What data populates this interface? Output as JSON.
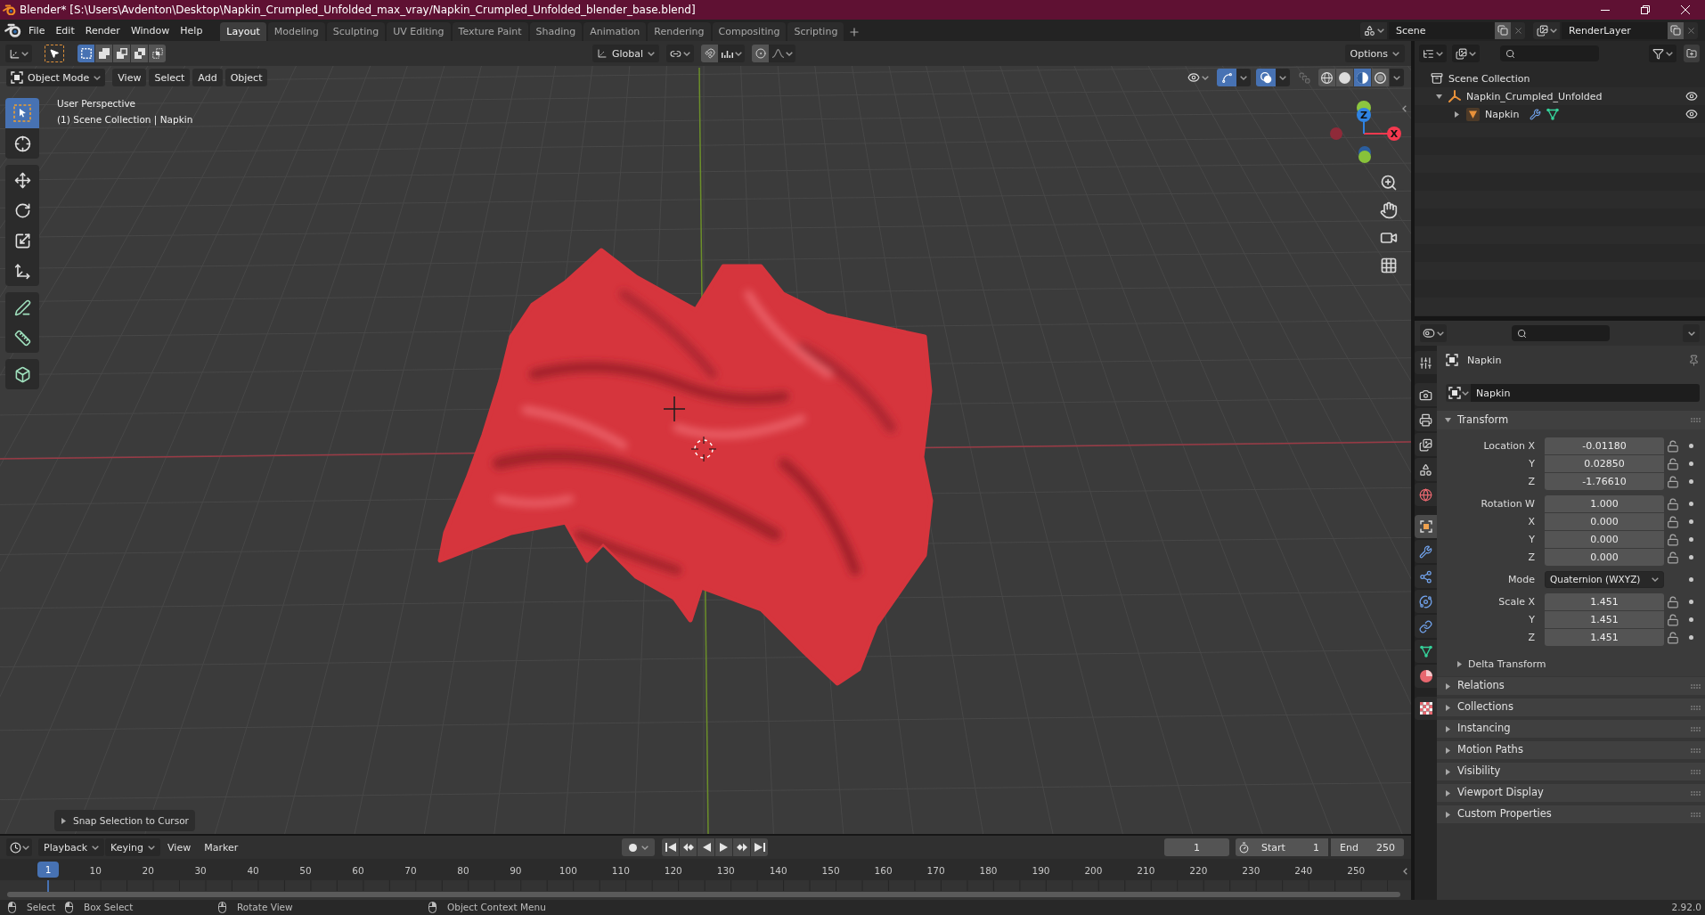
{
  "window": {
    "title": "Blender* [S:\\Users\\Avdenton\\Desktop\\Napkin_Crumpled_Unfolded_max_vray/Napkin_Crumpled_Unfolded_blender_base.blend]"
  },
  "menu": [
    "File",
    "Edit",
    "Render",
    "Window",
    "Help"
  ],
  "workspaces": [
    {
      "label": "Layout",
      "selected": true
    },
    {
      "label": "Modeling",
      "selected": false
    },
    {
      "label": "Sculpting",
      "selected": false
    },
    {
      "label": "UV Editing",
      "selected": false
    },
    {
      "label": "Texture Paint",
      "selected": false
    },
    {
      "label": "Shading",
      "selected": false
    },
    {
      "label": "Animation",
      "selected": false
    },
    {
      "label": "Rendering",
      "selected": false
    },
    {
      "label": "Compositing",
      "selected": false
    },
    {
      "label": "Scripting",
      "selected": false
    }
  ],
  "scene": {
    "value": "Scene"
  },
  "view_layer": {
    "value": "RenderLayer"
  },
  "viewport": {
    "tool_header": {
      "selection_modes": [
        {
          "kind": "set",
          "selected": true
        },
        {
          "kind": "extend",
          "selected": false
        },
        {
          "kind": "subtract",
          "selected": false
        },
        {
          "kind": "invert",
          "selected": false
        },
        {
          "kind": "intersect",
          "selected": false
        }
      ],
      "orientation": "Global",
      "options": "Options"
    },
    "header": {
      "mode": "Object Mode",
      "menus": [
        "View",
        "Select",
        "Add",
        "Object"
      ],
      "shading": [
        {
          "kind": "wireframe",
          "selected": false
        },
        {
          "kind": "solid",
          "selected": false
        },
        {
          "kind": "material",
          "selected": true
        },
        {
          "kind": "rendered",
          "selected": false
        }
      ]
    },
    "info": [
      "User Perspective",
      "(1) Scene Collection | Napkin"
    ],
    "tool_groups": [
      {
        "tools": [
          {
            "kind": "select_box",
            "selected": true
          },
          {
            "kind": "cursor",
            "selected": false
          }
        ]
      },
      {
        "tools": [
          {
            "kind": "move",
            "selected": false
          },
          {
            "kind": "rotate",
            "selected": false
          },
          {
            "kind": "scale",
            "selected": false
          },
          {
            "kind": "transform",
            "selected": false
          }
        ]
      },
      {
        "tools": [
          {
            "kind": "annotate",
            "selected": false
          },
          {
            "kind": "measure",
            "selected": false
          }
        ]
      },
      {
        "tools": [
          {
            "kind": "add_cube",
            "selected": false
          }
        ]
      }
    ],
    "navigation_gizmo": {
      "axes": [
        {
          "kind": "x",
          "label": "X"
        },
        {
          "kind": "z",
          "label": "Z"
        }
      ]
    },
    "last_operator": {
      "title": "Snap Selection to Cursor",
      "expanded": false
    }
  },
  "outliner": {
    "tree": [
      {
        "kind": "collection",
        "label": "Scene Collection",
        "children": [
          {
            "kind": "empty",
            "label": "Napkin_Crumpled_Unfolded",
            "expanded": true,
            "visible": true,
            "children": [
              {
                "kind": "mesh",
                "label": "Napkin",
                "expanded": false,
                "visible": true,
                "extras": [
                  {
                    "kind": "modifier"
                  },
                  {
                    "kind": "mesh_data"
                  }
                ]
              }
            ]
          }
        ]
      }
    ]
  },
  "properties": {
    "tab_groups": [
      {
        "tabs": [
          {
            "kind": "tool",
            "selected": false
          }
        ]
      },
      {
        "tabs": [
          {
            "kind": "render",
            "selected": false
          },
          {
            "kind": "output",
            "selected": false
          },
          {
            "kind": "view_layer",
            "selected": false
          },
          {
            "kind": "scene",
            "selected": false
          },
          {
            "kind": "world",
            "selected": false
          }
        ]
      },
      {
        "tabs": [
          {
            "kind": "object",
            "selected": true
          },
          {
            "kind": "modifiers",
            "selected": false
          },
          {
            "kind": "particles",
            "selected": false
          },
          {
            "kind": "physics",
            "selected": false
          },
          {
            "kind": "constraints",
            "selected": false
          },
          {
            "kind": "data",
            "selected": false
          },
          {
            "kind": "material",
            "selected": false
          }
        ]
      },
      {
        "tabs": [
          {
            "kind": "texture",
            "selected": false
          }
        ]
      }
    ],
    "context": "Napkin",
    "name": "Napkin",
    "transform": {
      "title": "Transform",
      "expanded": true,
      "sections": [
        {
          "kind": "fields",
          "rows": [
            {
              "label": "Location X",
              "value": "-0.01180",
              "locked": false
            },
            {
              "label": "Y",
              "value": "0.02850",
              "locked": false
            },
            {
              "label": "Z",
              "value": "-1.76610",
              "locked": false
            }
          ]
        },
        {
          "kind": "fields",
          "rows": [
            {
              "label": "Rotation W",
              "value": "1.000",
              "locked": false
            },
            {
              "label": "X",
              "value": "0.000",
              "locked": false
            },
            {
              "label": "Y",
              "value": "0.000",
              "locked": false
            },
            {
              "label": "Z",
              "value": "0.000",
              "locked": false
            }
          ]
        },
        {
          "kind": "dropdown",
          "label": "Mode",
          "value": "Quaternion (WXYZ)"
        },
        {
          "kind": "fields",
          "rows": [
            {
              "label": "Scale X",
              "value": "1.451",
              "locked": false
            },
            {
              "label": "Y",
              "value": "1.451",
              "locked": false
            },
            {
              "label": "Z",
              "value": "1.451",
              "locked": false
            }
          ]
        }
      ],
      "subpanels": [
        {
          "title": "Delta Transform",
          "expanded": false
        }
      ]
    },
    "panels": [
      {
        "title": "Relations",
        "expanded": false
      },
      {
        "title": "Collections",
        "expanded": false
      },
      {
        "title": "Instancing",
        "expanded": false
      },
      {
        "title": "Motion Paths",
        "expanded": false
      },
      {
        "title": "Visibility",
        "expanded": false
      },
      {
        "title": "Viewport Display",
        "expanded": false
      },
      {
        "title": "Custom Properties",
        "expanded": false
      }
    ]
  },
  "timeline": {
    "menus": [
      {
        "kind": "dropdown",
        "label": "Playback"
      },
      {
        "kind": "dropdown",
        "label": "Keying"
      },
      {
        "kind": "menu",
        "label": "View"
      },
      {
        "kind": "menu",
        "label": "Marker"
      }
    ],
    "current_frame": "1",
    "start": {
      "label": "Start",
      "value": "1"
    },
    "end": {
      "label": "End",
      "value": "250"
    },
    "ruler": {
      "current": "1",
      "ticks": [
        "10",
        "20",
        "30",
        "40",
        "50",
        "60",
        "70",
        "80",
        "90",
        "100",
        "110",
        "120",
        "130",
        "140",
        "150",
        "160",
        "170",
        "180",
        "190",
        "200",
        "210",
        "220",
        "230",
        "240",
        "250"
      ]
    }
  },
  "status_bar": {
    "items": [
      {
        "kind": "left_click",
        "label": "Select"
      },
      {
        "kind": "left_drag",
        "label": "Box Select"
      },
      {
        "kind": "middle_drag",
        "label": "Rotate View"
      },
      {
        "kind": "right_click",
        "label": "Object Context Menu"
      }
    ],
    "version": "2.92.0"
  }
}
